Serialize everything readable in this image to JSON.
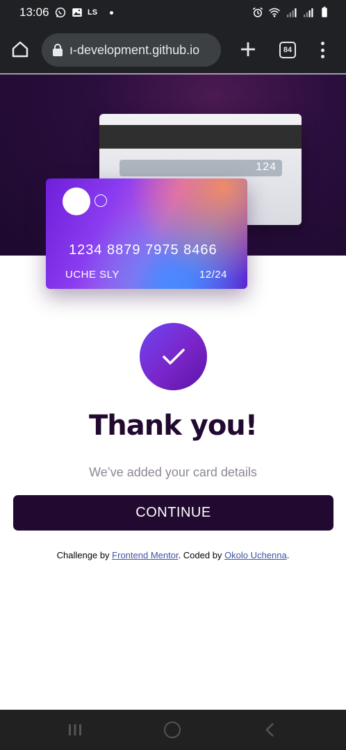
{
  "status_bar": {
    "time": "13:06",
    "carrier_label": "LS"
  },
  "browser": {
    "url": "ı-development.github.io",
    "tab_count": "84"
  },
  "card": {
    "number": "1234 8879 7975 8466",
    "holder_name": "UCHE SLY",
    "expiry": "12/24",
    "cvc": "124"
  },
  "success": {
    "title": "Thank you!",
    "subtitle": "We’ve added your card details",
    "button_label": "CONTINUE"
  },
  "attribution": {
    "prefix": "Challenge by ",
    "link1": "Frontend Mentor",
    "middle": ". Coded by ",
    "link2": "Okolo Uchenna",
    "suffix": "."
  },
  "colors": {
    "dark_violet": "#21092f",
    "grey_text": "#8e8593",
    "link_blue": "#3e52a3"
  }
}
